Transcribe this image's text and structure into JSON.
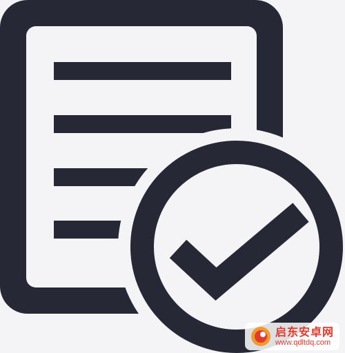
{
  "icon": {
    "name": "document-check-icon",
    "stroke_color": "#272836",
    "background_color": "#f4f4f6",
    "paper_color": "#f4f4f6"
  },
  "watermark": {
    "title": "启东安卓网",
    "url": "www.qdltdq.com",
    "accent_color": "#e23b2e",
    "logo_color": "#f29a2e"
  }
}
